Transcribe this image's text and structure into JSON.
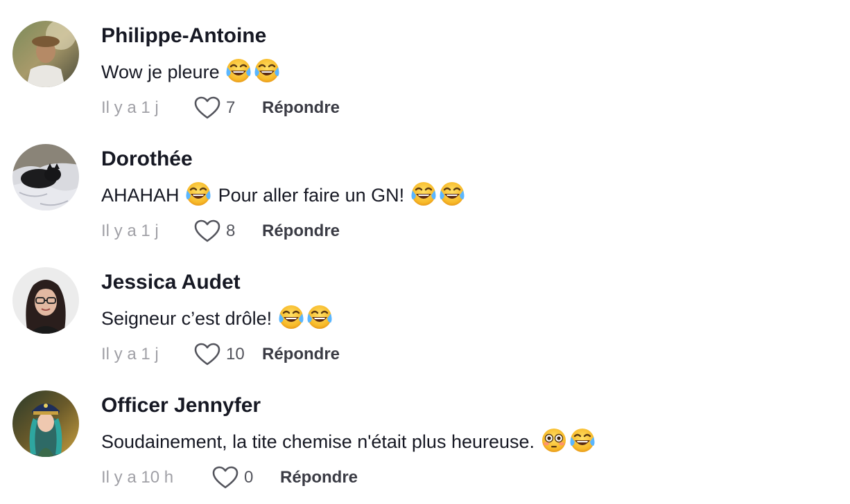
{
  "comments": [
    {
      "author": "Philippe-Antoine",
      "text": "Wow je pleure",
      "emojis_after": [
        "laughing-tears",
        "laughing-tears"
      ],
      "time": "Il y a 1 j",
      "likes": "7",
      "reply_label": "Répondre",
      "avatar": "person-outdoors-photo"
    },
    {
      "author": "Dorothée",
      "text_part1": "AHAHAH",
      "text_part2": "Pour aller faire un GN!",
      "emojis_mid": [
        "laughing-tears"
      ],
      "emojis_after": [
        "laughing-tears",
        "laughing-tears"
      ],
      "time": "Il y a 1 j",
      "likes": "8",
      "reply_label": "Répondre",
      "avatar": "black-cat-photo"
    },
    {
      "author": "Jessica Audet",
      "text": "Seigneur c’est drôle!",
      "emojis_after": [
        "laughing-tears",
        "laughing-tears"
      ],
      "time": "Il y a 1 j",
      "likes": "10",
      "reply_label": "Répondre",
      "avatar": "woman-glasses-photo"
    },
    {
      "author": "Officer Jennyfer",
      "text": "Soudainement, la tite chemise n'était plus heureuse.",
      "emojis_after": [
        "flushed-face",
        "laughing-tears"
      ],
      "time": "Il y a 10 h",
      "likes": "0",
      "reply_label": "Répondre",
      "avatar": "costumed-woman-photo"
    }
  ],
  "colors": {
    "name": "#161823",
    "body": "#161823",
    "meta": "#a0a0a6",
    "reply": "#3a3b44",
    "heart_stroke": "#53545c"
  }
}
